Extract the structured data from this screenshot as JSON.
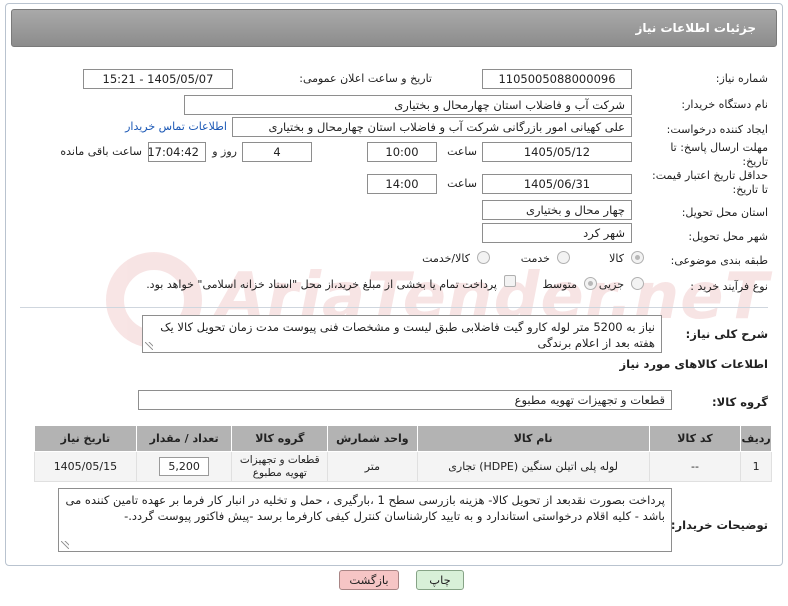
{
  "header": {
    "title": "جزئیات اطلاعات نیاز"
  },
  "form": {
    "need_number": {
      "label": "شماره نیاز:",
      "value": "1105005088000096"
    },
    "announce_datetime": {
      "label": "تاریخ و ساعت اعلان عمومی:",
      "value": "1405/05/07 - 15:21"
    },
    "buyer_org": {
      "label": "نام دستگاه خریدار:",
      "value": "شرکت آب و فاضلاب استان چهارمحال و بختیاری"
    },
    "requester": {
      "label": "ایجاد کننده درخواست:",
      "value": "علی کهیانی امور بازرگانی شرکت آب و فاضلاب استان چهارمحال و بختیاری",
      "contact_link": "اطلاعات تماس خریدار"
    },
    "response_deadline": {
      "label_line1": "مهلت ارسال پاسخ: تا",
      "label_line2": "تاریخ:",
      "date": "1405/05/12",
      "time_label": "ساعت",
      "time": "10:00",
      "days": "4",
      "days_label": "روز و",
      "remaining": "17:04:42",
      "remaining_label": "ساعت باقی مانده"
    },
    "price_validity": {
      "label_line1": "حداقل تاریخ اعتبار قیمت:",
      "label_line2": "تا تاریخ:",
      "date": "1405/06/31",
      "time_label": "ساعت",
      "time": "14:00"
    },
    "delivery_province": {
      "label": "استان محل تحویل:",
      "value": "چهار محال و بختیاری"
    },
    "delivery_city": {
      "label": "شهر محل تحویل:",
      "value": "شهر کرد"
    },
    "category": {
      "label": "طبقه بندی موضوعی:",
      "options": [
        "کالا",
        "خدمت",
        "کالا/خدمت"
      ]
    },
    "purchase_type": {
      "label": "نوع فرآیند خرید :",
      "options": [
        "جزیی",
        "متوسط"
      ],
      "payment_note": "پرداخت تمام یا بخشی از مبلغ خرید،از محل \"اسناد خزانه اسلامی\" خواهد بود."
    }
  },
  "description": {
    "label": "شرح کلی نیاز:",
    "value": "نیاز به 5200 متر لوله کارو گیت فاضلابی طبق لیست و مشخصات فنی پیوست مدت زمان تحویل کالا یک هفته بعد از اعلام برندگی"
  },
  "goods_info": {
    "title": "اطلاعات کالاهای مورد نیاز",
    "group_label": "گروه کالا:",
    "group_value": "قطعات و تجهیزات تهویه مطبوع"
  },
  "table": {
    "headers": [
      "ردیف",
      "کد کالا",
      "نام کالا",
      "واحد شمارش",
      "گروه کالا",
      "تعداد / مقدار",
      "تاریخ نیاز"
    ],
    "rows": [
      {
        "row": "1",
        "code": "--",
        "name": "لوله پلی اتیلن سنگین (HDPE) تجاری",
        "unit": "متر",
        "group": "قطعات و تجهیزات تهویه مطبوع",
        "qty": "5,200",
        "date": "1405/05/15"
      }
    ]
  },
  "buyer_notes": {
    "label": "توضیحات خریدار:",
    "value": "پرداخت بصورت نقدبعد از تحویل کالا- هزینه بازرسی سطح 1 ،بارگیری ، حمل و تخلیه در انبار کار فرما بر عهده تامین کننده می باشد  -  کلیه اقلام درخواستی استاندارد و به تایید کارشناسان کنترل کیفی کارفرما برسد -پیش فاکتور پیوست گردد.-"
  },
  "buttons": {
    "back": "بازگشت",
    "print": "چاپ"
  },
  "watermark": {
    "text": "AriaTender.neT"
  }
}
